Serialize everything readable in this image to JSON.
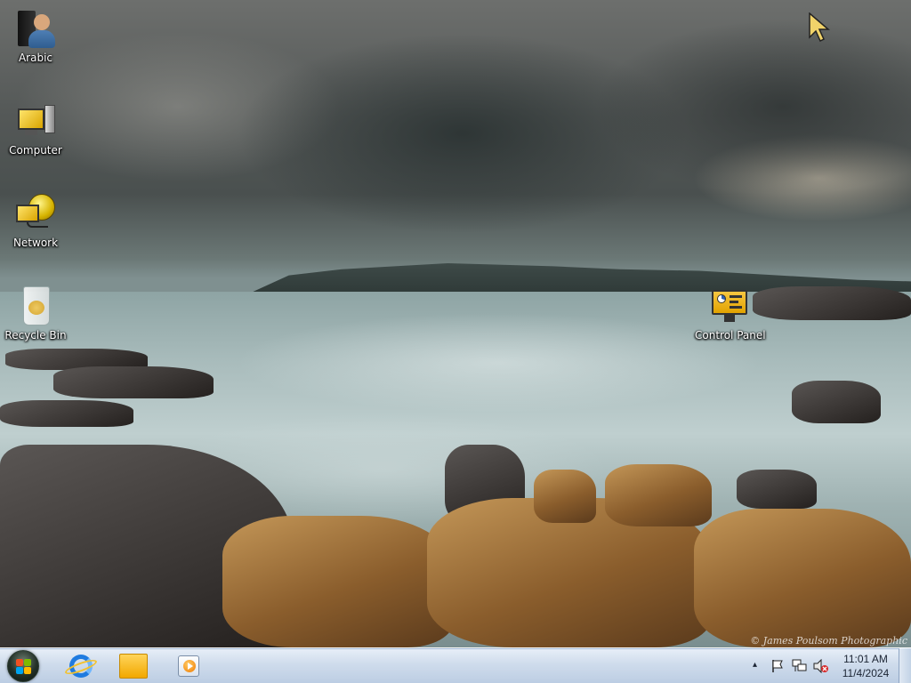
{
  "desktop": {
    "icons": {
      "user_folder": {
        "label": "Arabic",
        "icon": "user-folder-icon"
      },
      "computer": {
        "label": "Computer",
        "icon": "computer-icon"
      },
      "network": {
        "label": "Network",
        "icon": "network-icon"
      },
      "recycle_bin": {
        "label": "Recycle Bin",
        "icon": "recycle-bin-icon"
      },
      "control_panel": {
        "label": "Control Panel",
        "icon": "control-panel-icon"
      }
    },
    "watermark": "© James Poulsom Photographic"
  },
  "taskbar": {
    "start_button": {
      "icon": "windows-start-orb-icon"
    },
    "pinned": [
      {
        "name": "Internet Explorer",
        "icon": "internet-explorer-icon"
      },
      {
        "name": "Windows Explorer",
        "icon": "folder-icon"
      },
      {
        "name": "Windows Media Player",
        "icon": "media-player-icon"
      }
    ],
    "tray": {
      "show_hidden": "▴",
      "action_center_icon": "flag-icon",
      "network_icon": "network-tray-icon",
      "volume_icon": "volume-muted-icon"
    },
    "clock": {
      "time": "11:01 AM",
      "date": "11/4/2024"
    }
  },
  "colors": {
    "taskbar_top": "#e8eff8",
    "taskbar_bottom": "#bccde3",
    "cursor": "#f1d36a"
  }
}
